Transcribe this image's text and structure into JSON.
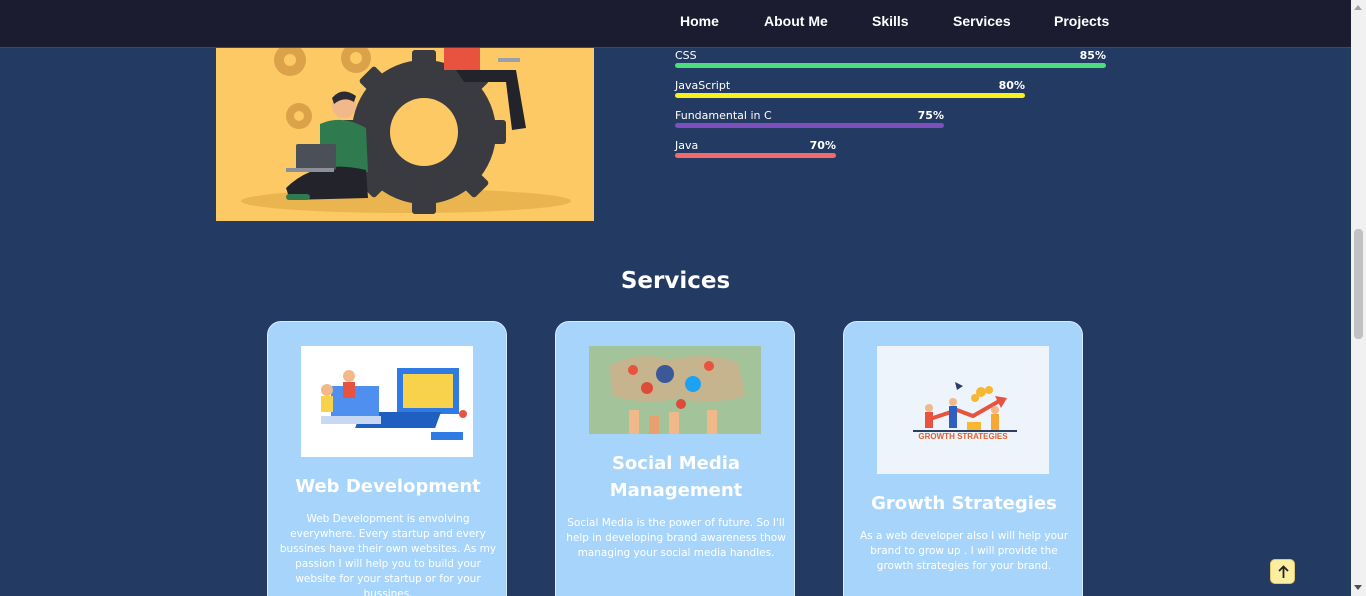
{
  "nav": {
    "items": [
      "Home",
      "About Me",
      "Skills",
      "Services",
      "Projects"
    ]
  },
  "skills": [
    {
      "name": "CSS",
      "percent": 85,
      "percent_label": "85%",
      "color": "#4cdd7c"
    },
    {
      "name": "JavaScript",
      "percent": 80,
      "percent_label": "80%",
      "color": "#f7f21b"
    },
    {
      "name": "Fundamental in C",
      "percent": 75,
      "percent_label": "75%",
      "color": "#7c4fbd"
    },
    {
      "name": "Java",
      "percent": 70,
      "percent_label": "70%",
      "color": "#f46a6a"
    }
  ],
  "services": {
    "title": "Services",
    "cards": [
      {
        "title": "Web Development",
        "text": "Web Development is envolving everywhere. Every startup and every bussines have their own websites. As my passion I will help you to build your website for your startup or for your bussines."
      },
      {
        "title": "Social Media Management",
        "text": "Social Media is the power of future. So I'll help in developing brand awareness thow managing your social media handles."
      },
      {
        "title": "Growth Strategies",
        "text": "As a web developer also I will help your brand to grow up . I will provide the growth strategies for your brand.",
        "image_caption": "GROWTH STRATEGIES"
      }
    ]
  },
  "colors": {
    "page_bg": "#233a63",
    "nav_bg": "#1c1c31",
    "card_bg": "#a7d4fb",
    "hero_bg": "#fdc965"
  },
  "icons": {
    "back_to_top": "arrow-up-icon"
  }
}
